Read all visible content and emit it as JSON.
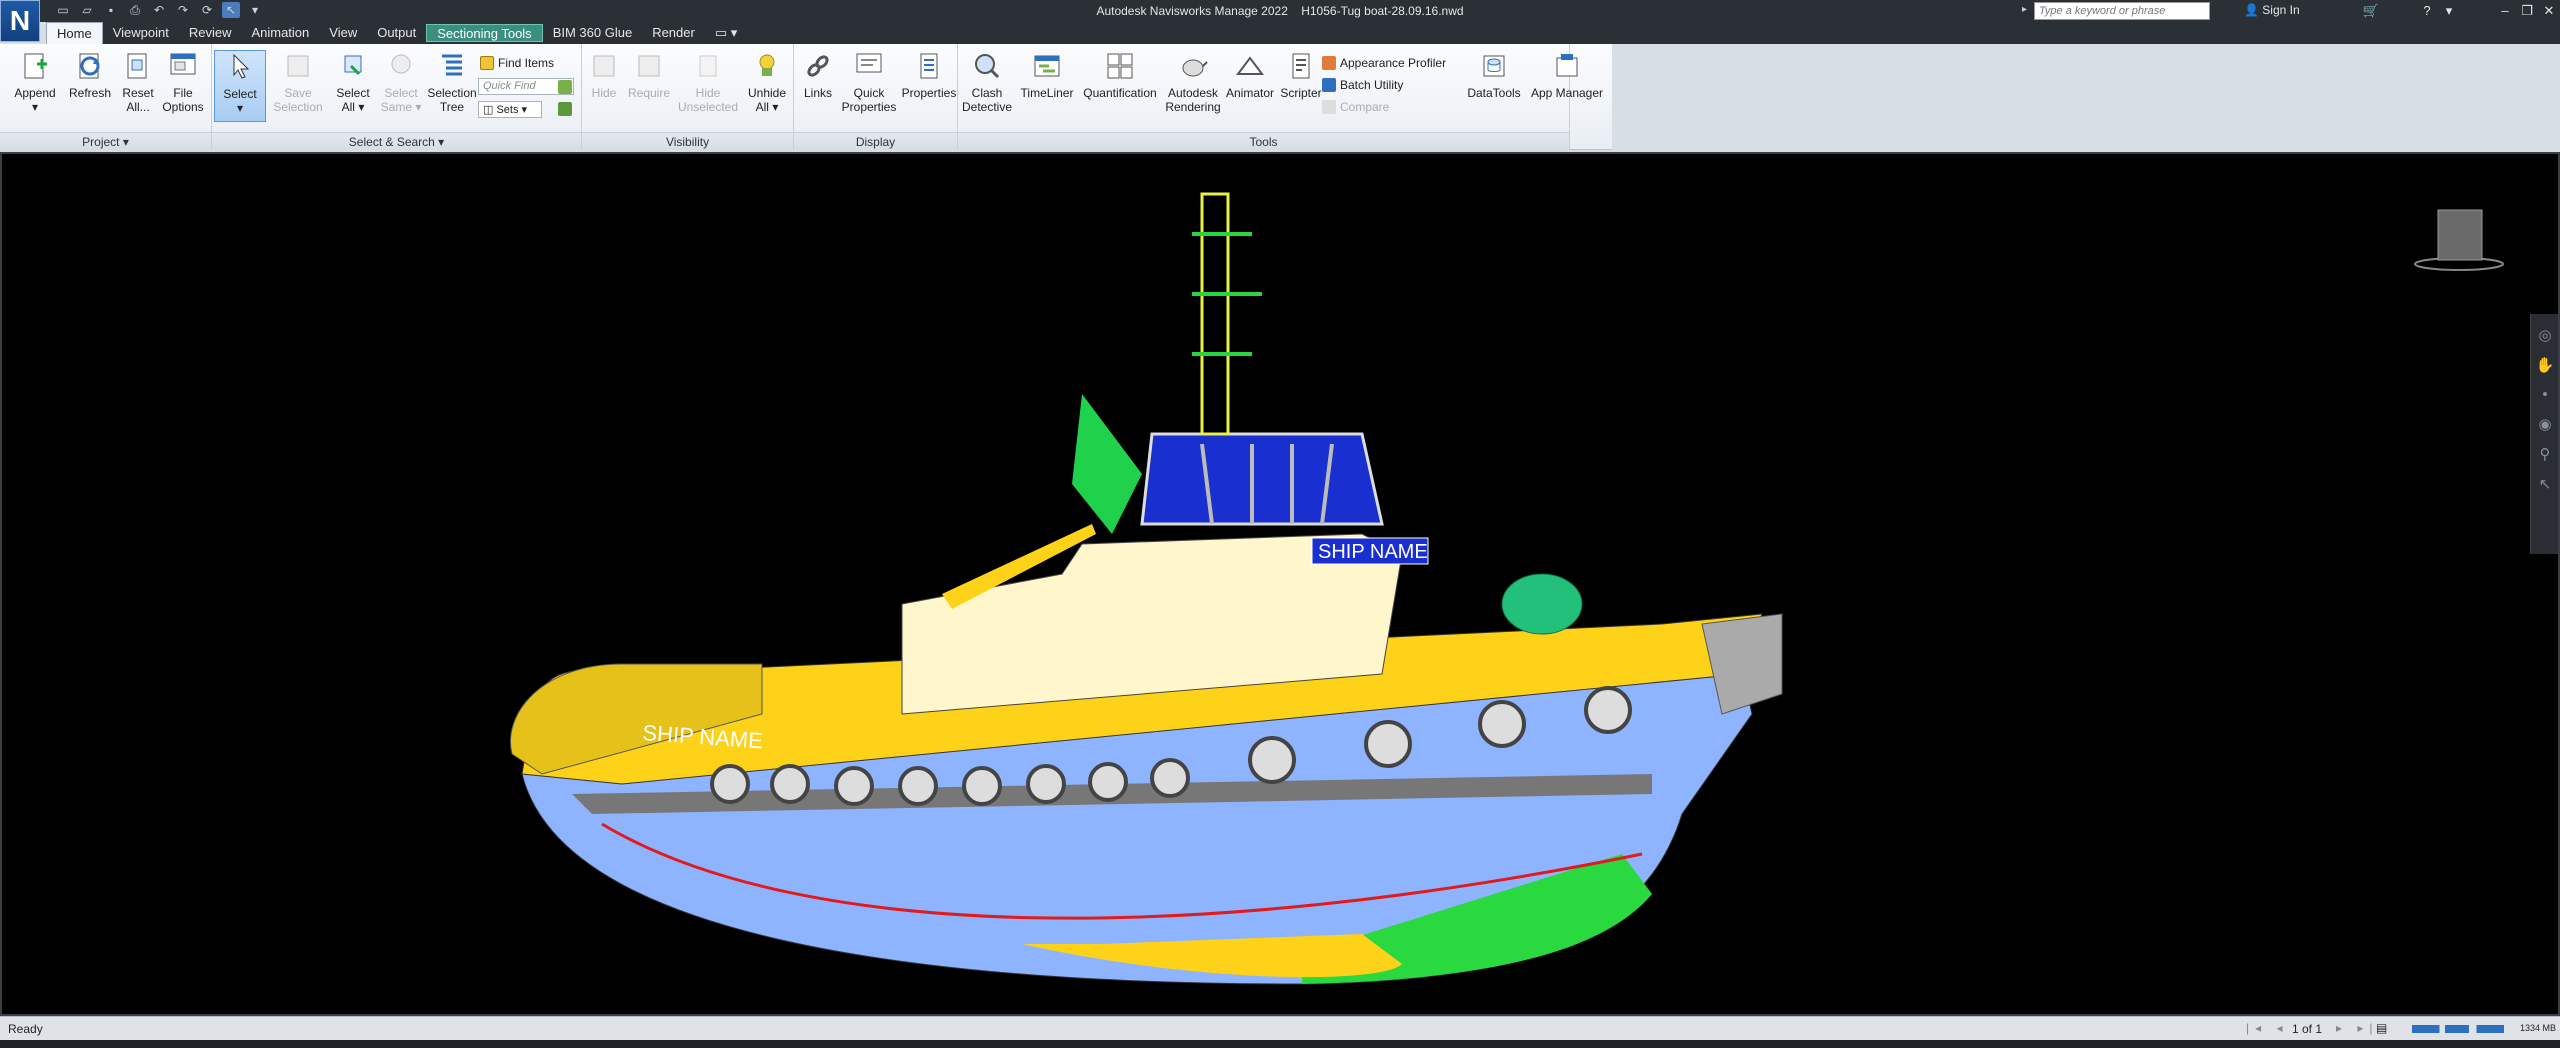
{
  "window": {
    "app_title": "Autodesk Navisworks Manage 2022",
    "file_name": "H1056-Tug boat-28.09.16.nwd",
    "logo_letter": "N",
    "search_placeholder": "Type a keyword or phrase",
    "sign_in": "Sign In"
  },
  "tabs": [
    {
      "label": "Home",
      "active": true
    },
    {
      "label": "Viewpoint"
    },
    {
      "label": "Review"
    },
    {
      "label": "Animation"
    },
    {
      "label": "View"
    },
    {
      "label": "Output"
    },
    {
      "label": "Sectioning Tools",
      "contextual": true
    },
    {
      "label": "BIM 360 Glue"
    },
    {
      "label": "Render"
    }
  ],
  "ribbon": {
    "project": {
      "label": "Project",
      "append": "Append",
      "refresh": "Refresh",
      "reset_all": [
        "Reset",
        "All..."
      ],
      "file_options": [
        "File",
        "Options"
      ]
    },
    "select_search": {
      "label": "Select & Search",
      "select": "Select",
      "save_selection": [
        "Save",
        "Selection"
      ],
      "select_all": [
        "Select",
        "All"
      ],
      "select_same": [
        "Select",
        "Same"
      ],
      "selection_tree": [
        "Selection",
        "Tree"
      ],
      "find_items": "Find Items",
      "quick_find_placeholder": "Quick Find",
      "sets": "Sets"
    },
    "visibility": {
      "label": "Visibility",
      "hide": "Hide",
      "require": "Require",
      "hide_unselected": [
        "Hide",
        "Unselected"
      ],
      "unhide_all": [
        "Unhide",
        "All"
      ]
    },
    "display": {
      "label": "Display",
      "links": "Links",
      "quick_properties": [
        "Quick",
        "Properties"
      ],
      "properties": "Properties"
    },
    "tools": {
      "label": "Tools",
      "clash_detective": [
        "Clash",
        "Detective"
      ],
      "timeliner": "TimeLiner",
      "quantification": "Quantification",
      "autodesk_rendering": [
        "Autodesk",
        "Rendering"
      ],
      "animator": "Animator",
      "scripter": "Scripter",
      "appearance_profiler": "Appearance Profiler",
      "batch_utility": "Batch Utility",
      "compare": "Compare"
    },
    "datatools": "DataTools",
    "app_manager": "App Manager"
  },
  "model": {
    "ship_name_label": "SHIP NAME"
  },
  "status": {
    "text": "Ready",
    "pages": "1 of 1",
    "memory": "1334 MB"
  },
  "colors": {
    "accent": "#4a7dbd",
    "hull": "#8fb4ff",
    "deck": "#ffd21a",
    "superstructure": "#fff6cc",
    "green": "#1fd14b"
  }
}
